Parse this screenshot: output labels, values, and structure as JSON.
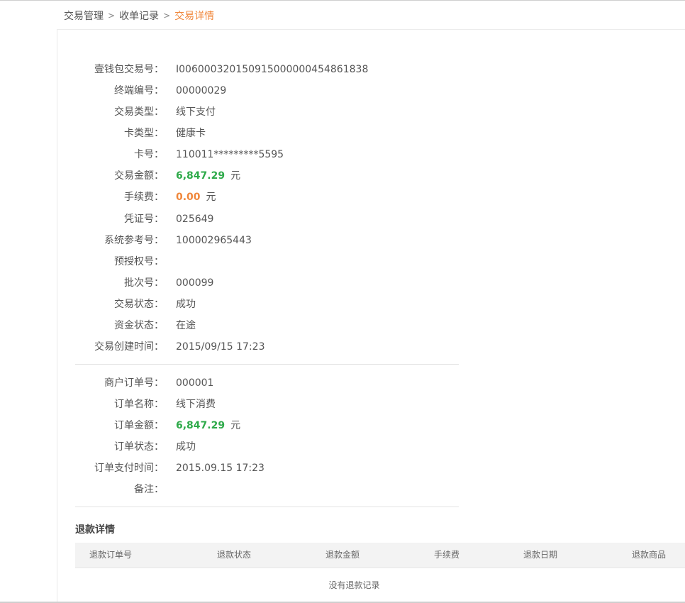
{
  "breadcrumb": {
    "items": [
      "交易管理",
      "收单记录",
      "交易详情"
    ],
    "separator": ">"
  },
  "transaction": {
    "wallet_no_label": "壹钱包交易号：",
    "wallet_no": "I006000320150915000000454861838",
    "terminal_label": "终端编号：",
    "terminal": "00000029",
    "type_label": "交易类型：",
    "type": "线下支付",
    "card_type_label": "卡类型：",
    "card_type": "健康卡",
    "card_no_label": "卡号：",
    "card_no": "110011*********5595",
    "amount_label": "交易金额：",
    "amount": "6,847.29",
    "amount_unit": "元",
    "fee_label": "手续费：",
    "fee": "0.00",
    "fee_unit": "元",
    "voucher_label": "凭证号：",
    "voucher": "025649",
    "ref_label": "系统参考号：",
    "ref": "100002965443",
    "preauth_label": "预授权号：",
    "preauth": "",
    "batch_label": "批次号：",
    "batch": "000099",
    "status_label": "交易状态：",
    "status": "成功",
    "fund_status_label": "资金状态：",
    "fund_status": "在途",
    "created_label": "交易创建时间：",
    "created": "2015/09/15 17:23"
  },
  "order": {
    "order_no_label": "商户订单号：",
    "order_no": "000001",
    "name_label": "订单名称：",
    "name": "线下消费",
    "amount_label": "订单金额：",
    "amount": "6,847.29",
    "amount_unit": "元",
    "status_label": "订单状态：",
    "status": "成功",
    "pay_time_label": "订单支付时间：",
    "pay_time": "2015.09.15 17:23",
    "remark_label": "备注：",
    "remark": ""
  },
  "refund": {
    "title": "退款详情",
    "columns": [
      "退款订单号",
      "退款状态",
      "退款金额",
      "手续费",
      "退款日期",
      "退款商品"
    ],
    "empty_text": "没有退款记录"
  },
  "colors": {
    "accent_orange": "#f0873b",
    "amount_green": "#2eaa4a"
  }
}
